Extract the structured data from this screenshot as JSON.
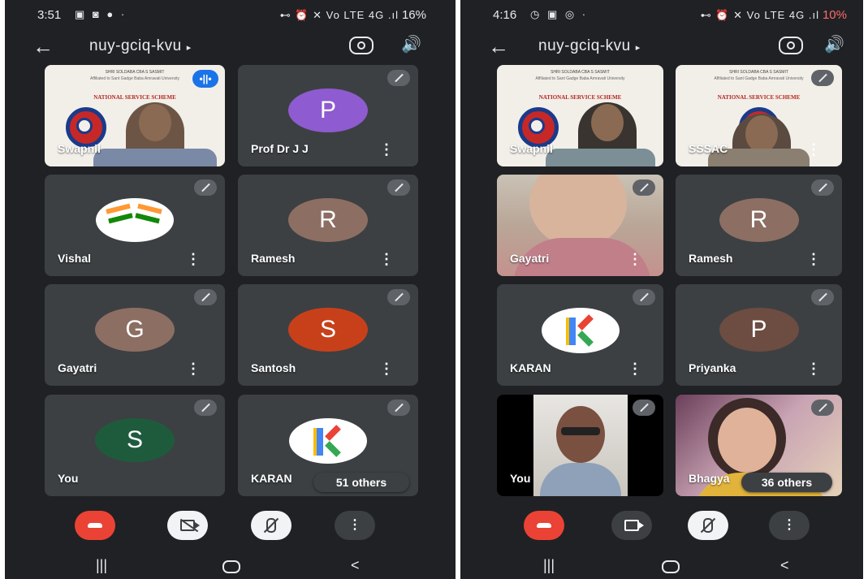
{
  "left": {
    "status": {
      "time": "3:51",
      "icons": "▣ ◙ ● ·",
      "right": "⊷ ⏰ ✕ Vo LTE 4G .ıl",
      "battery": "16%"
    },
    "meeting_code": "nuy-gciq-kvu",
    "tiles": [
      {
        "name": "Swapnil",
        "kind": "poster"
      },
      {
        "name": "Prof Dr J J",
        "initial": "P",
        "color": "#8e5bd0"
      },
      {
        "name": "Vishal",
        "kind": "flags"
      },
      {
        "name": "Ramesh",
        "initial": "R",
        "color": "#8d6e63"
      },
      {
        "name": "Gayatri",
        "initial": "G",
        "color": "#8d6e63"
      },
      {
        "name": "Santosh",
        "initial": "S",
        "color": "#c8401a"
      },
      {
        "name": "You",
        "initial": "S",
        "color": "#1e5b3c"
      },
      {
        "name": "KARAN",
        "kind": "logo"
      }
    ],
    "others": "51 others",
    "poster": {
      "line1": "SHRI SOLDABA CBA S SASMIT",
      "line2": "Affiliated to Sant Gadge Baba Amravati University",
      "heading": "NATIONAL SERVICE SCHEME"
    }
  },
  "right": {
    "status": {
      "time": "4:16",
      "icons": "◷ ▣ ◎ ·",
      "right": "⊷ ⏰ ✕ Vo LTE 4G .ıl",
      "battery": "10%"
    },
    "meeting_code": "nuy-gciq-kvu",
    "tiles": [
      {
        "name": "Swapnil",
        "kind": "poster"
      },
      {
        "name": "SSSAC",
        "kind": "poster"
      },
      {
        "name": "Gayatri",
        "kind": "video"
      },
      {
        "name": "Ramesh",
        "initial": "R",
        "color": "#8d6e63"
      },
      {
        "name": "KARAN",
        "kind": "logo"
      },
      {
        "name": "Priyanka",
        "initial": "P",
        "color": "#6d4c41"
      },
      {
        "name": "You",
        "kind": "video"
      },
      {
        "name": "Bhagya",
        "kind": "video"
      }
    ],
    "others": "36 others",
    "poster": {
      "line1": "SHRI SOLDABA CBA S SASMIT",
      "line2": "Affiliated to Sant Gadge Baba Amravati University",
      "heading": "NATIONAL SERVICE SCHEME"
    }
  },
  "icons": {
    "back": "←",
    "caret": "▸",
    "speaker": "🔊",
    "more": "⋮",
    "nav_recents": "|||",
    "nav_back": "<"
  }
}
